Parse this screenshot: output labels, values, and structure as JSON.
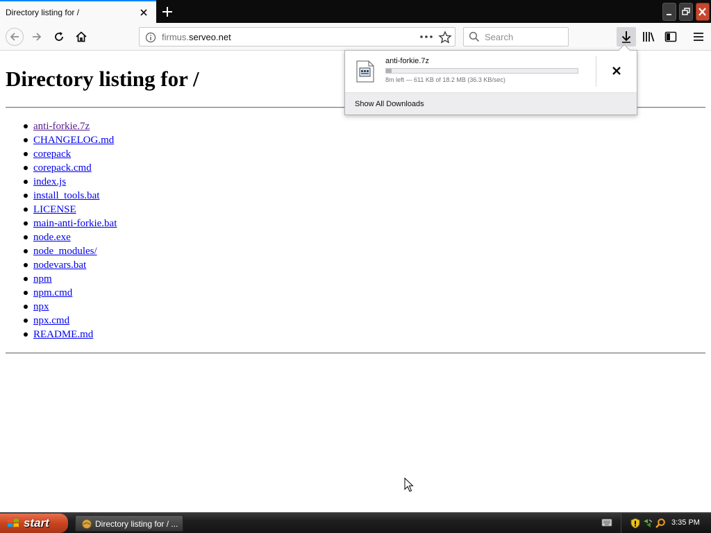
{
  "browser": {
    "tab_title": "Directory listing for /",
    "url_prefix": "firmus.",
    "url_host": "serveo.net",
    "search_placeholder": "Search"
  },
  "page": {
    "heading": "Directory listing for /",
    "files": [
      {
        "name": "anti-forkie.7z",
        "visited": true
      },
      {
        "name": "CHANGELOG.md",
        "visited": false
      },
      {
        "name": "corepack",
        "visited": false
      },
      {
        "name": "corepack.cmd",
        "visited": false
      },
      {
        "name": "index.js",
        "visited": false
      },
      {
        "name": "install_tools.bat",
        "visited": false
      },
      {
        "name": "LICENSE",
        "visited": false
      },
      {
        "name": "main-anti-forkie.bat",
        "visited": false
      },
      {
        "name": "node.exe",
        "visited": false
      },
      {
        "name": "node_modules/",
        "visited": false
      },
      {
        "name": "nodevars.bat",
        "visited": false
      },
      {
        "name": "npm",
        "visited": false
      },
      {
        "name": "npm.cmd",
        "visited": false
      },
      {
        "name": "npx",
        "visited": false
      },
      {
        "name": "npx.cmd",
        "visited": false
      },
      {
        "name": "README.md",
        "visited": false
      }
    ]
  },
  "downloads": {
    "file_name": "anti-forkie.7z",
    "progress_fraction": 0.03,
    "status": "8m left — 611 KB of 18.2 MB (36.3 KB/sec)",
    "show_all_label": "Show All Downloads"
  },
  "taskbar": {
    "start_label": "start",
    "task_label": "Directory listing for / ...",
    "clock": "3:35 PM"
  },
  "colors": {
    "accent": "#0a84ff",
    "link": "#0000ee",
    "visited_link": "#551a8b"
  }
}
